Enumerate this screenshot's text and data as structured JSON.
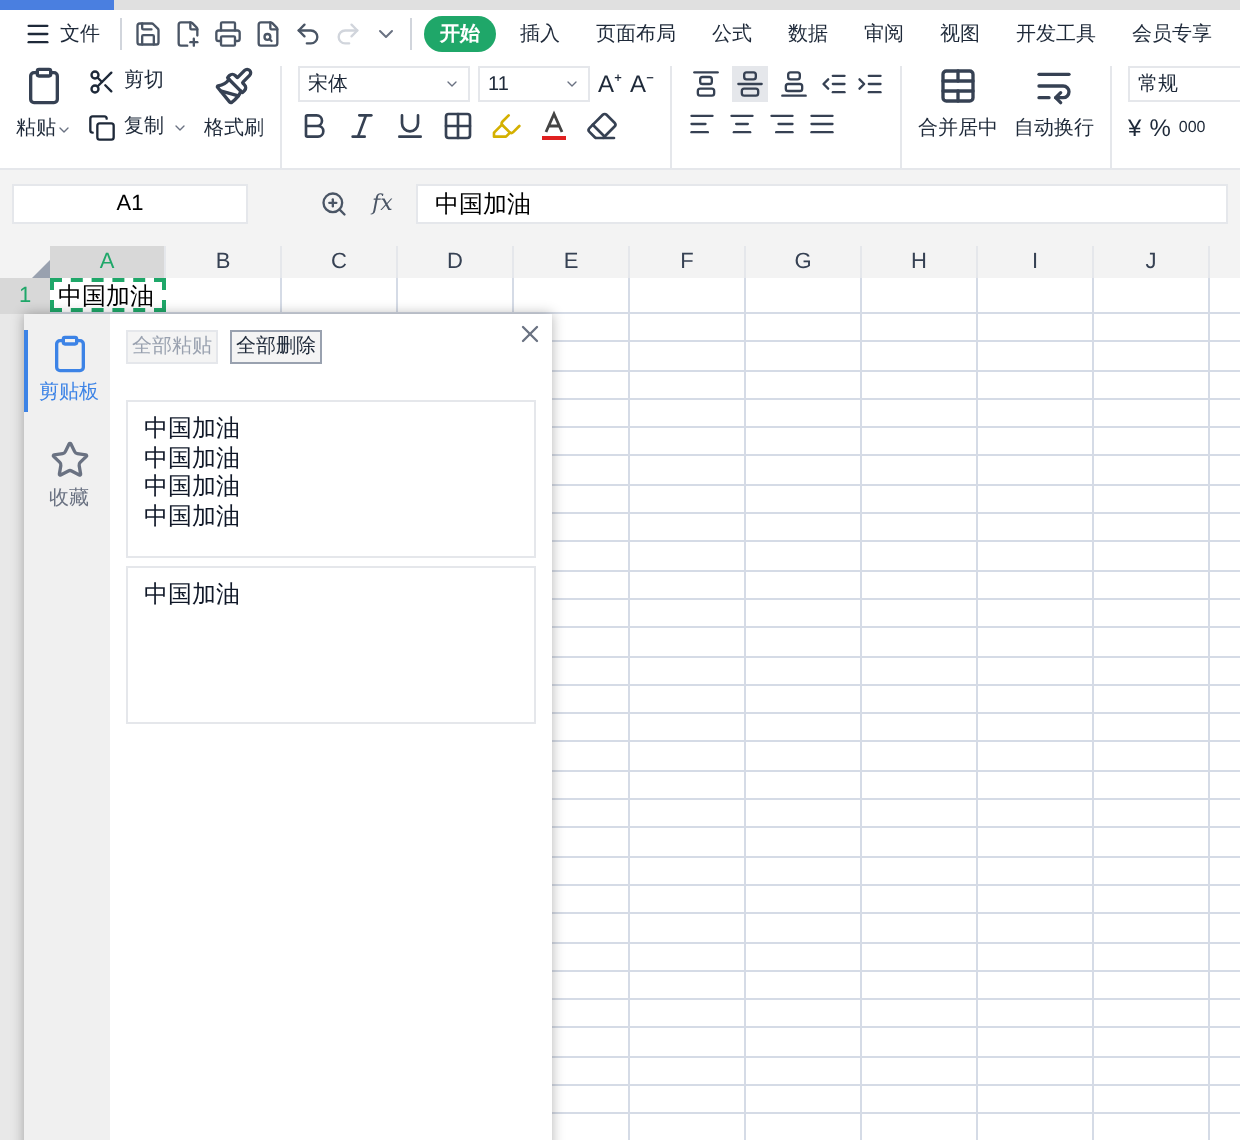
{
  "menu": {
    "file_label": "文件",
    "tabs": [
      {
        "label": "开始",
        "selected": true
      },
      {
        "label": "插入",
        "selected": false
      },
      {
        "label": "页面布局",
        "selected": false
      },
      {
        "label": "公式",
        "selected": false
      },
      {
        "label": "数据",
        "selected": false
      },
      {
        "label": "审阅",
        "selected": false
      },
      {
        "label": "视图",
        "selected": false
      },
      {
        "label": "开发工具",
        "selected": false
      },
      {
        "label": "会员专享",
        "selected": false
      }
    ]
  },
  "ribbon": {
    "paste": "粘贴",
    "cut": "剪切",
    "copy": "复制",
    "format_painter": "格式刷",
    "font_name": "宋体",
    "font_size": "11",
    "grow_font": "A⁺",
    "shrink_font": "A⁻",
    "vertical_align": [
      {
        "selected": false
      },
      {
        "selected": true
      },
      {
        "selected": false
      }
    ],
    "merge": "合并居中",
    "wrap": "自动换行",
    "number_format": "常规",
    "currency": "¥",
    "percent": "%",
    "thousands": "000"
  },
  "formula_bar": {
    "cell_ref": "A1",
    "function_label": "fx",
    "formula": "中国加油"
  },
  "sheet": {
    "columns": [
      {
        "label": "A",
        "selected": true
      },
      {
        "label": "B",
        "selected": false
      },
      {
        "label": "C",
        "selected": false
      },
      {
        "label": "D",
        "selected": false
      },
      {
        "label": "E",
        "selected": false
      },
      {
        "label": "F",
        "selected": false
      },
      {
        "label": "G",
        "selected": false
      },
      {
        "label": "H",
        "selected": false
      },
      {
        "label": "I",
        "selected": false
      },
      {
        "label": "J",
        "selected": false
      }
    ],
    "first_row": {
      "number": "1",
      "cell": "中国加油"
    }
  },
  "clipboard_panel": {
    "nav": [
      {
        "label": "剪贴板",
        "kind": "clipboard",
        "selected": true
      },
      {
        "label": "收藏",
        "kind": "favorites",
        "selected": false
      }
    ],
    "buttons": [
      {
        "label": "全部粘贴",
        "disabled": true
      },
      {
        "label": "全部删除",
        "disabled": false
      }
    ],
    "items": [
      {
        "lines": [
          "中国加油",
          "中国加油",
          "中国加油",
          "中国加油"
        ]
      },
      {
        "lines": [
          "中国加油"
        ]
      }
    ]
  }
}
